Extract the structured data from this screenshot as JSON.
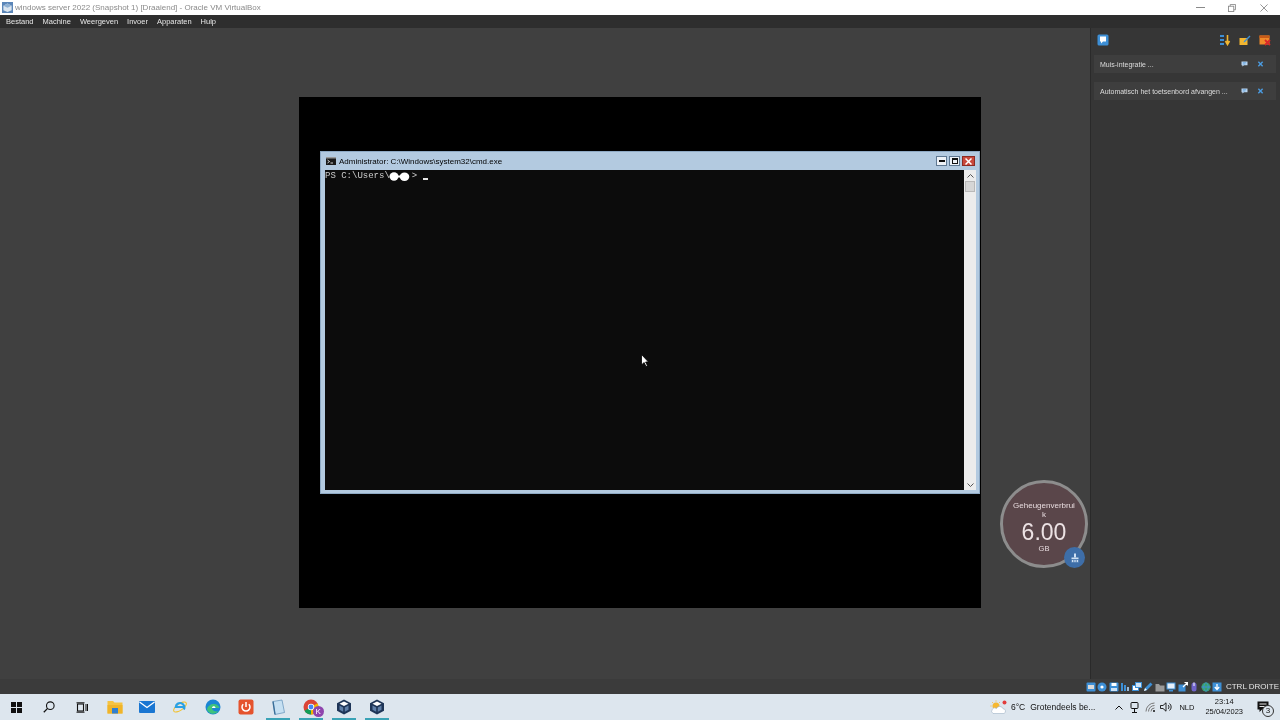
{
  "window": {
    "title": "windows server 2022 (Snapshot 1) [Draaiend] - Oracle VM VirtualBox"
  },
  "menu_bar": {
    "items": [
      "Bestand",
      "Machine",
      "Weergeven",
      "Invoer",
      "Apparaten",
      "Hulp"
    ]
  },
  "guest_screen": {
    "console_window": {
      "title": "Administrator: C:\\Windows\\system32\\cmd.exe",
      "prompt": "PS C:\\Users\\",
      "prompt_end": ">"
    }
  },
  "memory_gauge": {
    "label": "Geheugenverbruik",
    "value": "6.00",
    "unit": "GB"
  },
  "side_panel": {
    "notifications": [
      {
        "text": "Muis-integratie ..."
      },
      {
        "text": "Automatisch het toetsenbord afvangen ..."
      }
    ]
  },
  "status_bar": {
    "host_key": "CTRL DROITE"
  },
  "taskbar": {
    "apps": [
      {
        "kind": "folder",
        "running": false
      },
      {
        "kind": "mail",
        "running": false
      },
      {
        "kind": "ie",
        "running": false
      },
      {
        "kind": "edge",
        "running": false
      },
      {
        "kind": "power",
        "running": false
      },
      {
        "kind": "notepad",
        "running": true
      },
      {
        "kind": "chrome",
        "running": true,
        "badge": "K"
      },
      {
        "kind": "cube",
        "running": true
      },
      {
        "kind": "cube",
        "running": true
      }
    ],
    "weather": {
      "temperature": "6°C",
      "summary": "Grotendeels be..."
    },
    "language": "NLD",
    "time": "23:14",
    "date": "25/04/2023",
    "notification_count": "3"
  }
}
